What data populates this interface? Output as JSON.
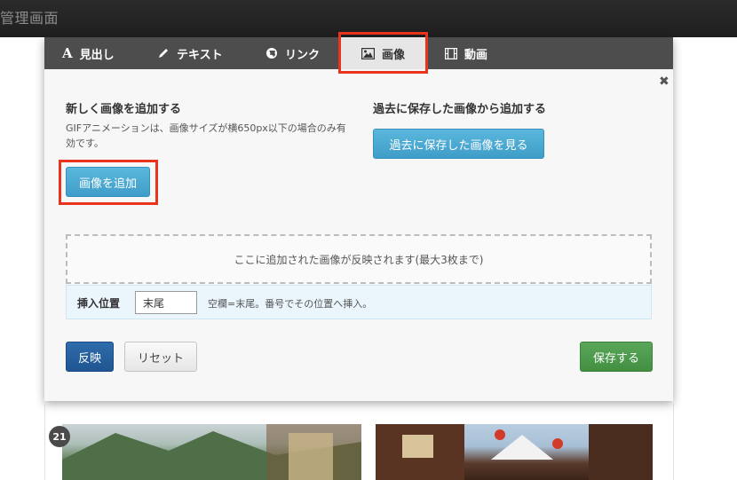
{
  "app": {
    "title": "管理画面"
  },
  "tabs": [
    {
      "label": "見出し",
      "icon": "heading-icon"
    },
    {
      "label": "テキスト",
      "icon": "pencil-icon"
    },
    {
      "label": "リンク",
      "icon": "globe-icon"
    },
    {
      "label": "画像",
      "icon": "image-icon",
      "active": true
    },
    {
      "label": "動画",
      "icon": "film-icon"
    }
  ],
  "close_label": "✖",
  "new_image": {
    "title": "新しく画像を追加する",
    "help": "GIFアニメーションは、画像サイズが横650px以下の場合のみ有効です。",
    "add_button": "画像を追加"
  },
  "past_image": {
    "title": "過去に保存した画像から追加する",
    "button": "過去に保存した画像を見る"
  },
  "dropzone": {
    "text": "ここに追加された画像が反映されます(最大3枚まで)"
  },
  "insert": {
    "label": "挿入位置",
    "value": "末尾",
    "note": "空欄=末尾。番号でその位置へ挿入。"
  },
  "footer": {
    "apply": "反映",
    "reset": "リセット",
    "save": "保存する"
  },
  "background": {
    "badge": "21"
  },
  "colors": {
    "highlight": "#e8341c",
    "accent_blue": "#3e9dc8",
    "save_green": "#428f42",
    "apply_navy": "#1f5592"
  }
}
